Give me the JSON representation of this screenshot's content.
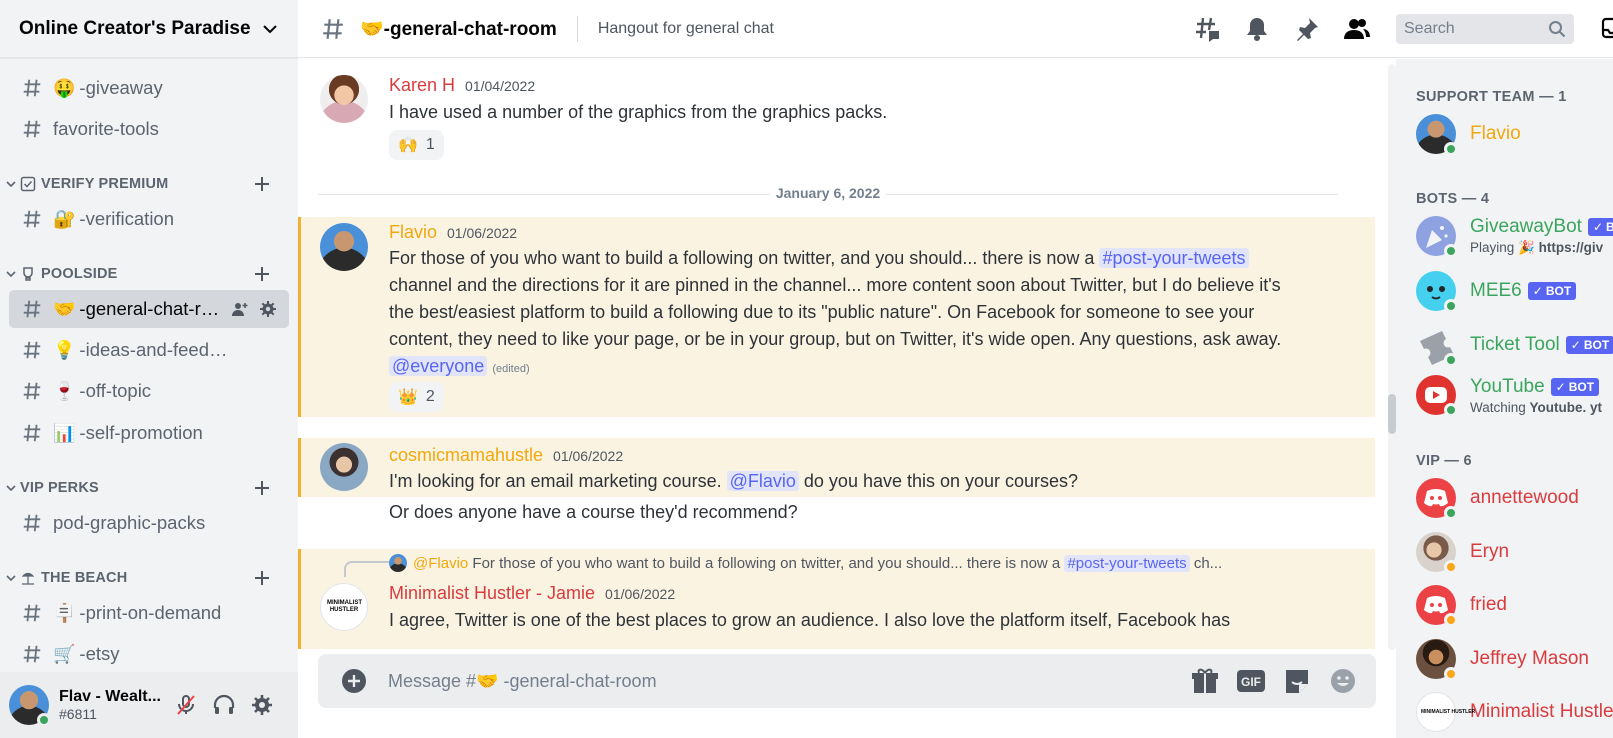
{
  "server": {
    "name": "Online Creator's Paradise"
  },
  "sidebar": {
    "channels_top": [
      {
        "emoji": "🤑",
        "label": "-giveaway"
      },
      {
        "emoji": "",
        "label": "favorite-tools"
      }
    ],
    "categories": [
      {
        "name": "VERIFY PREMIUM",
        "channels": [
          {
            "emoji": "🔐",
            "label": "-verification"
          }
        ]
      },
      {
        "name": "POOLSIDE",
        "channels": [
          {
            "emoji": "🤝",
            "label": "-general-chat-room",
            "active": true
          },
          {
            "emoji": "💡",
            "label": "-ideas-and-feedback"
          },
          {
            "emoji": "🍷",
            "label": "-off-topic"
          },
          {
            "emoji": "📊",
            "label": "-self-promotion"
          }
        ]
      },
      {
        "name": "VIP PERKS",
        "channels": [
          {
            "emoji": "",
            "label": "pod-graphic-packs"
          }
        ]
      },
      {
        "name": "THE BEACH",
        "channels": [
          {
            "emoji": "🪧",
            "label": "-print-on-demand"
          },
          {
            "emoji": "🛒",
            "label": "-etsy"
          }
        ]
      }
    ]
  },
  "user_panel": {
    "name": "Flav - Wealt...",
    "tag": "#6811"
  },
  "topbar": {
    "channel_emoji": "🤝",
    "channel_name": "-general-chat-room",
    "topic": "Hangout for general chat",
    "search_placeholder": "Search"
  },
  "messages": {
    "m1": {
      "author": "Karen H",
      "author_color": "#d83c3e",
      "time": "01/04/2022",
      "text": "I have used a number of the graphics from the graphics packs.",
      "reaction": {
        "emoji": "🙌",
        "count": "1"
      }
    },
    "date_divider": "January 6, 2022",
    "m2": {
      "author": "Flavio",
      "author_color": "#f1a80d",
      "time": "01/06/2022",
      "text_a": "For those of you who want to build a following on twitter, and you should... there is now a",
      "channel_mention": "post-your-tweets",
      "text_b": "channel and the directions for it are pinned in the channel... more content soon about Twitter, but I do believe it's the best/easiest platform to build a following due to its \"public nature\".  On Facebook for someone to see your content, they need to like your page, or be in your group, but on Twitter, it's wide open.  Any questions, ask away.",
      "mention": "@everyone",
      "edited": "(edited)",
      "reaction": {
        "emoji": "👑",
        "count": "2"
      }
    },
    "m3": {
      "author": "cosmicmamahustle",
      "author_color": "#f1a80d",
      "time": "01/06/2022",
      "text_a": "I'm looking for an email marketing course.",
      "mention": "@Flavio",
      "text_b": "do you have this on your courses?",
      "followup": "Or does anyone have a course they'd recommend?"
    },
    "m4": {
      "reply_author": "@Flavio",
      "reply_text": "For those of you who want to build a following on twitter, and you should... there is now a",
      "reply_channel": "post-your-tweets",
      "reply_tail": "ch...",
      "author": "Minimalist Hustler - Jamie",
      "author_color": "#d83c3e",
      "time": "01/06/2022",
      "avatar_text": "MINIMALIST HUSTLER",
      "text": "I agree, Twitter is one of the best places to grow an audience. I also love the platform itself, Facebook has"
    }
  },
  "composer": {
    "placeholder_prefix": "Message #",
    "emoji": "🤝",
    "placeholder_channel": "-general-chat-room",
    "gif_label": "GIF"
  },
  "members": {
    "groups": [
      {
        "title": "SUPPORT TEAM — 1"
      },
      {
        "title": "BOTS — 4"
      },
      {
        "title": "VIP — 6"
      }
    ],
    "support": [
      {
        "name": "Flavio",
        "color": "#f1a80d"
      }
    ],
    "bots": [
      {
        "name": "GiveawayBot",
        "color": "#3ba55d",
        "sub_prefix": "Playing 🎉 ",
        "sub_bold": "https://giv",
        "tag": "B"
      },
      {
        "name": "MEE6",
        "color": "#3ba55d",
        "tag": "BOT"
      },
      {
        "name": "Ticket Tool",
        "color": "#3ba55d",
        "tag": "BOT"
      },
      {
        "name": "YouTube",
        "color": "#3ba55d",
        "tag": "BOT",
        "sub_prefix": "Watching ",
        "sub_bold": "Youtube. yt"
      }
    ],
    "vip": [
      {
        "name": "annettewood",
        "color": "#d83c3e"
      },
      {
        "name": "Eryn",
        "color": "#d83c3e"
      },
      {
        "name": "fried",
        "color": "#d83c3e"
      },
      {
        "name": "Jeffrey Mason",
        "color": "#d83c3e"
      },
      {
        "name": "Minimalist Hustle",
        "color": "#d83c3e",
        "avatar_text": "MINIMALIST HUSTLER"
      }
    ]
  }
}
